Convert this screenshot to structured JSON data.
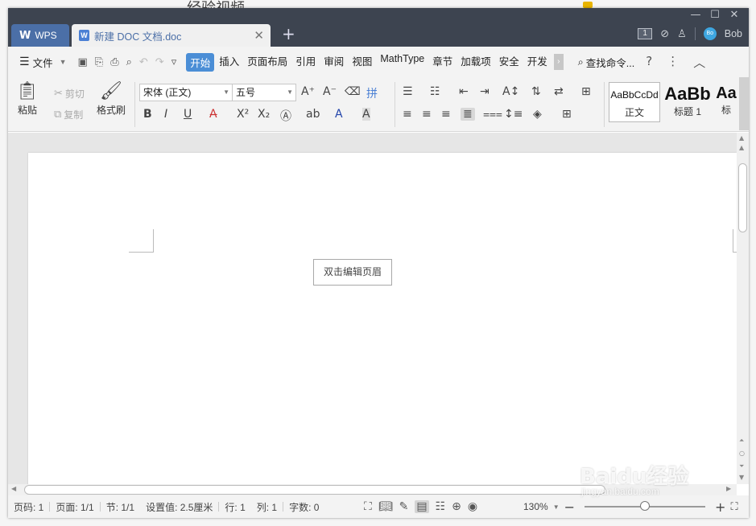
{
  "background": {
    "partial_title": "经验视频"
  },
  "window_controls": {
    "minimize": "—",
    "maximize": "☐",
    "close": "✕"
  },
  "tabs": {
    "home_tab": {
      "logo": "W",
      "label": "WPS"
    },
    "doc_tab": {
      "icon_letter": "W",
      "label": "新建 DOC 文档.doc",
      "close": "✕"
    },
    "new_tab": "+"
  },
  "titlebar_right": {
    "window_count": "1",
    "user_initials": "Bo",
    "user_name": "Bob"
  },
  "menubar": {
    "file_label": "文件",
    "tabs": [
      "开始",
      "插入",
      "页面布局",
      "引用",
      "审阅",
      "视图",
      "MathType",
      "章节",
      "加载项",
      "安全",
      "开发"
    ],
    "active_tab": "开始",
    "find_command": "查找命令...",
    "help": "?"
  },
  "ribbon": {
    "paste": "粘贴",
    "cut": "剪切",
    "copy": "复制",
    "format_painter": "格式刷",
    "font_name": "宋体 (正文)",
    "font_size": "五号",
    "styles": [
      {
        "preview": "AaBbCcDd",
        "name": "正文"
      },
      {
        "preview": "AaBb",
        "name": "标题 1"
      },
      {
        "preview": "Aa",
        "name": "标"
      }
    ]
  },
  "document": {
    "header_hint": "双击编辑页眉"
  },
  "statusbar": {
    "page_num": "页码: 1",
    "pages": "页面: 1/1",
    "section": "节: 1/1",
    "setting": "设置值: 2.5厘米",
    "row": "行: 1",
    "col": "列: 1",
    "words": "字数: 0",
    "zoom": "130%",
    "zoom_level": 1.3
  },
  "watermark": {
    "main": "Baidu经验",
    "sub": "jingyan.baidu.com"
  },
  "colors": {
    "titlebar": "#3d4450",
    "accent": "#4b8ed6",
    "wps_tab": "#4b6fa7"
  }
}
